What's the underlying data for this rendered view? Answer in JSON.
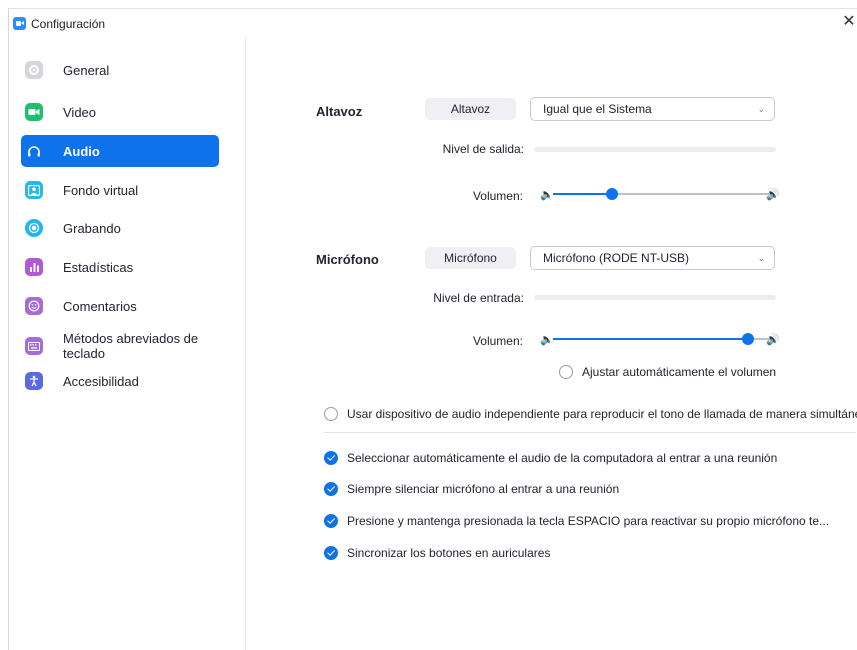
{
  "window": {
    "title": "Configuración",
    "close_glyph": "✕"
  },
  "sidebar": {
    "items": [
      {
        "label": "General",
        "icon": "gear-icon",
        "color": "#d5d5db",
        "active": false
      },
      {
        "label": "Video",
        "icon": "video-icon",
        "color": "#1dc16b",
        "active": false
      },
      {
        "label": "Audio",
        "icon": "headphones-icon",
        "color": "#0e72ed",
        "active": true
      },
      {
        "label": "Fondo virtual",
        "icon": "person-icon",
        "color": "#27b8e6",
        "active": false
      },
      {
        "label": "Grabando",
        "icon": "record-icon",
        "color": "#22b5f0",
        "active": false
      },
      {
        "label": "Estadísticas",
        "icon": "chart-icon",
        "color": "#b15ad4",
        "active": false
      },
      {
        "label": "Comentarios",
        "icon": "smile-icon",
        "color": "#a56bd9",
        "active": false
      },
      {
        "label": "Métodos abreviados de teclado",
        "icon": "keyboard-icon",
        "color": "#a56bd9",
        "active": false
      },
      {
        "label": "Accesibilidad",
        "icon": "accessibility-icon",
        "color": "#5a6be0",
        "active": false
      }
    ]
  },
  "speaker": {
    "section_label": "Altavoz",
    "test_button": "Altavoz",
    "device": "Igual que el Sistema",
    "level_label": "Nivel de salida:",
    "volume_label": "Volumen:",
    "volume_fraction": 0.27
  },
  "mic": {
    "section_label": "Micrófono",
    "test_button": "Micrófono",
    "device": "Micrófono (RODE NT-USB)",
    "level_label": "Nivel de entrada:",
    "volume_label": "Volumen:",
    "volume_fraction": 0.89,
    "auto_adjust_label": "Ajustar automáticamente el volumen",
    "auto_adjust_checked": false
  },
  "options": [
    {
      "label": "Usar dispositivo de audio independiente para reproducir el tono de llamada de manera simultánea",
      "checked": false
    },
    {
      "label": "Seleccionar automáticamente el audio de la computadora al entrar a una reunión",
      "checked": true
    },
    {
      "label": "Siempre silenciar micrófono al entrar a una reunión",
      "checked": true
    },
    {
      "label": "Presione y mantenga presionada la tecla ESPACIO para reactivar su propio micrófono te...",
      "checked": true
    },
    {
      "label": "Sincronizar los botones en auriculares",
      "checked": true
    }
  ],
  "colors": {
    "accent": "#0e72ed"
  }
}
